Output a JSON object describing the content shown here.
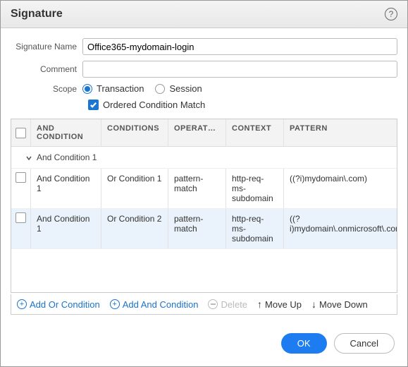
{
  "title": "Signature",
  "form": {
    "signatureNameLabel": "Signature Name",
    "signatureNameValue": "Office365-mydomain-login",
    "commentLabel": "Comment",
    "commentValue": "",
    "scopeLabel": "Scope",
    "scopeOptions": {
      "transaction": "Transaction",
      "session": "Session"
    },
    "orderedLabel": "Ordered Condition Match"
  },
  "table": {
    "headers": {
      "and": "And Condition",
      "conditions": "Conditions",
      "operator": "Operator",
      "context": "Context",
      "pattern": "Pattern"
    },
    "groupLabel": "And Condition 1",
    "rows": [
      {
        "and": "And Condition 1",
        "or": "Or Condition 1",
        "op": "pattern-match",
        "ctx": "http-req-ms-subdomain",
        "pat": "((?i)mydomain\\.com)"
      },
      {
        "and": "And Condition 1",
        "or": "Or Condition 2",
        "op": "pattern-match",
        "ctx": "http-req-ms-subdomain",
        "pat": "((?i)mydomain\\.onmicrosoft\\.com)"
      }
    ]
  },
  "toolbar": {
    "addOr": "Add Or Condition",
    "addAnd": "Add And Condition",
    "delete": "Delete",
    "moveUp": "Move Up",
    "moveDown": "Move Down"
  },
  "footer": {
    "ok": "OK",
    "cancel": "Cancel"
  }
}
